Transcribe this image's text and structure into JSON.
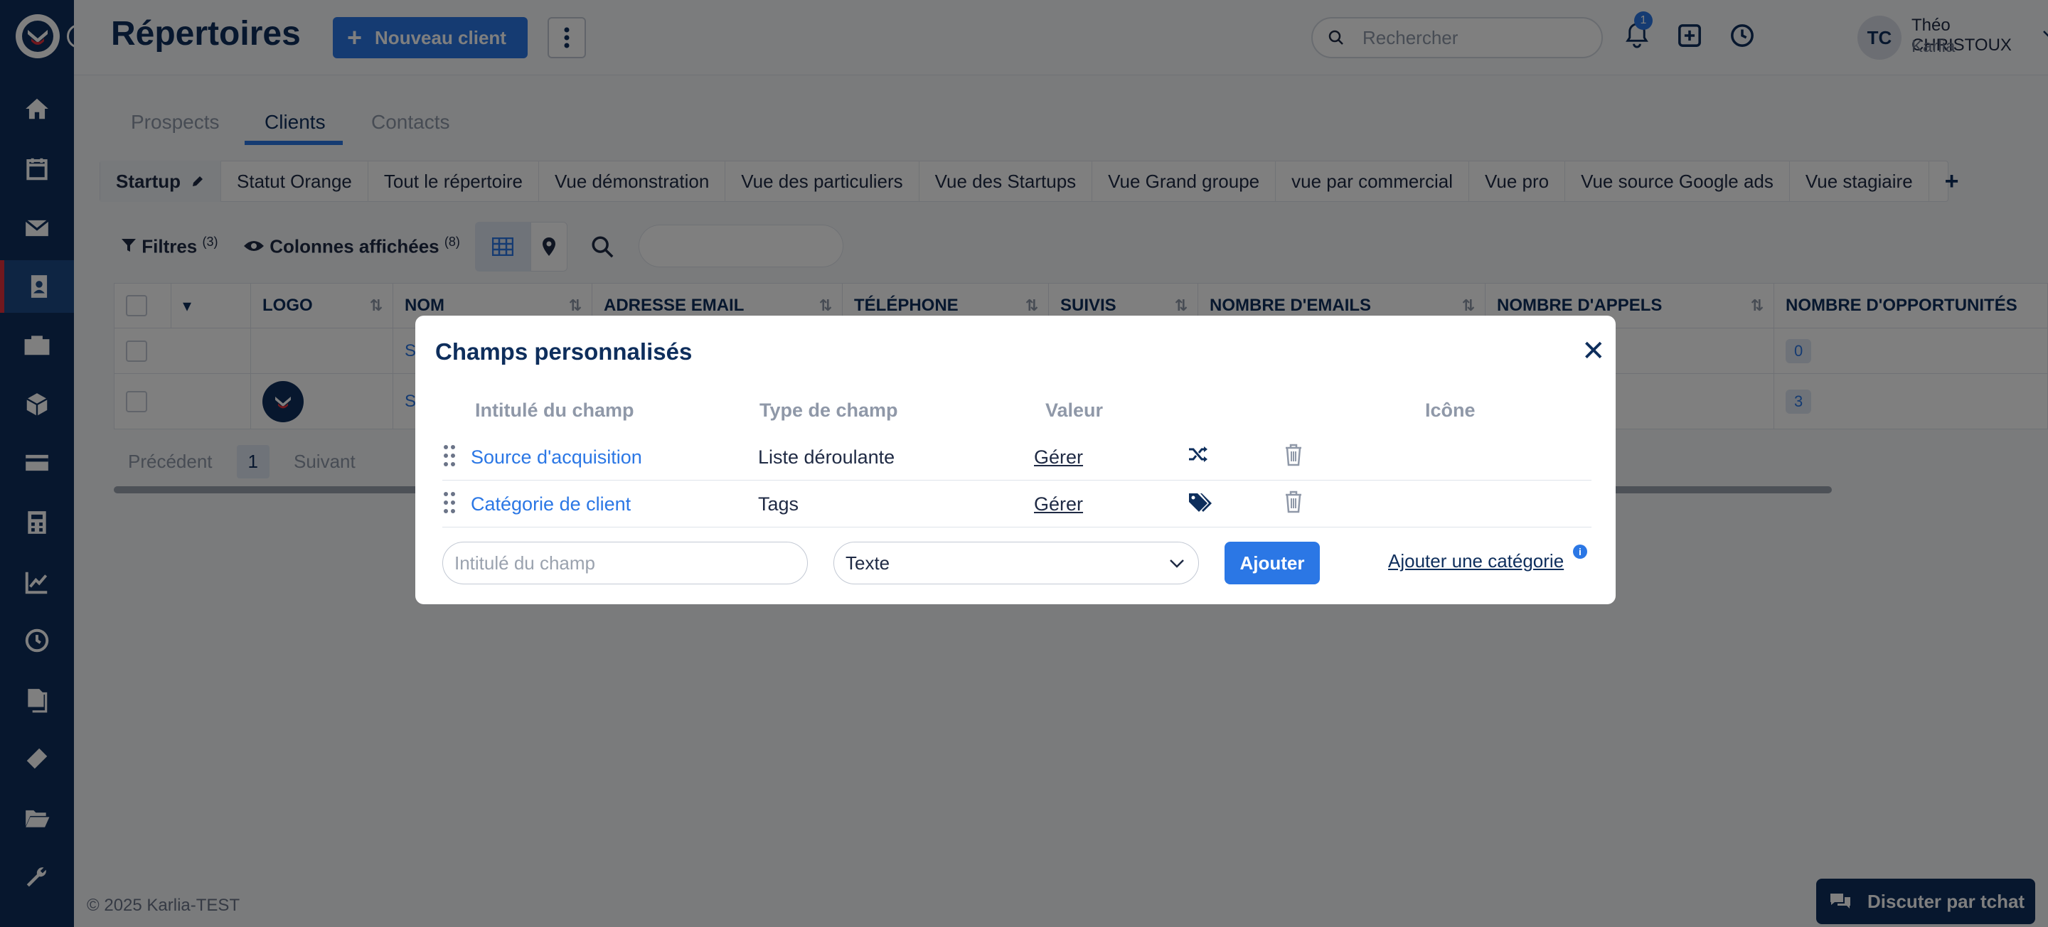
{
  "header": {
    "title": "Répertoires",
    "new_client_label": "Nouveau client",
    "search_placeholder": "Rechercher",
    "notification_count": "1",
    "user_initials": "TC",
    "user_name": "Théo CHRISTOUX",
    "user_org": "Karlia",
    "help_label": "?"
  },
  "tabs": [
    {
      "label": "Prospects",
      "active": false
    },
    {
      "label": "Clients",
      "active": true
    },
    {
      "label": "Contacts",
      "active": false
    }
  ],
  "views": [
    "Startup",
    "Statut Orange",
    "Tout le répertoire",
    "Vue démonstration",
    "Vue des particuliers",
    "Vue des Startups",
    "Vue Grand groupe",
    "vue par commercial",
    "Vue pro",
    "Vue source Google ads",
    "Vue stagiaire"
  ],
  "toolbar": {
    "filters_label": "Filtres",
    "filters_count": "(3)",
    "columns_label": "Colonnes affichées",
    "columns_count": "(8)"
  },
  "table": {
    "columns": [
      "Logo",
      "Nom",
      "Adresse email",
      "Téléphone",
      "Suivis",
      "Nombre d'emails",
      "Nombre d'appels",
      "Nombre d'opportunités"
    ],
    "rows": [
      {
        "name": "S",
        "opportunities": "0"
      },
      {
        "name": "S",
        "opportunities": "3"
      }
    ]
  },
  "pager": {
    "prev": "Précédent",
    "current": "1",
    "next": "Suivant"
  },
  "footer": "© 2025 Karlia-TEST",
  "chat_label": "Discuter par tchat",
  "modal": {
    "title": "Champs personnalisés",
    "close": "✕",
    "headers": {
      "name": "Intitulé du champ",
      "type": "Type de champ",
      "value": "Valeur",
      "icon": "Icône"
    },
    "fields": [
      {
        "name": "Source d'acquisition",
        "type": "Liste déroulante",
        "value": "Gérer",
        "icon": "shuffle-icon"
      },
      {
        "name": "Catégorie de client",
        "type": "Tags",
        "value": "Gérer",
        "icon": "tags-icon"
      }
    ],
    "new_field_placeholder": "Intitulé du champ",
    "type_select_value": "Texte",
    "add_label": "Ajouter",
    "add_category_label": "Ajouter une catégorie",
    "info_label": "i"
  }
}
